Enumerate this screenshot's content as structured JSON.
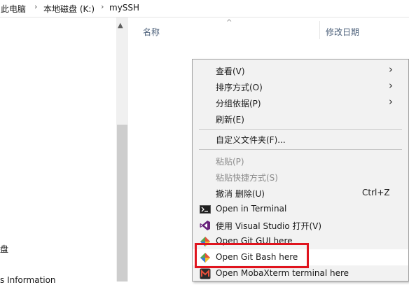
{
  "breadcrumb": {
    "items": [
      "此电脑",
      "本地磁盘 (K:)",
      "mySSH"
    ]
  },
  "nav": {
    "fragments": [
      "盘",
      "s Information"
    ]
  },
  "file_list": {
    "columns": [
      "名称",
      "修改日期"
    ]
  },
  "context_menu": {
    "items": [
      {
        "label": "查看(V)",
        "submenu": true
      },
      {
        "label": "排序方式(O)",
        "submenu": true
      },
      {
        "label": "分组依据(P)",
        "submenu": true
      },
      {
        "label": "刷新(E)"
      },
      {
        "label": "自定义文件夹(F)..."
      },
      {
        "label": "粘贴(P)",
        "disabled": true
      },
      {
        "label": "粘贴快捷方式(S)",
        "disabled": true
      },
      {
        "label": "撤消 删除(U)",
        "shortcut": "Ctrl+Z"
      },
      {
        "label": "Open in Terminal",
        "icon": "terminal-icon"
      },
      {
        "label": "使用 Visual Studio 打开(V)",
        "icon": "visual-studio-icon"
      },
      {
        "label": "Open Git GUI here",
        "icon": "git-icon"
      },
      {
        "label": "Open Git Bash here",
        "icon": "git-icon",
        "highlighted": true
      },
      {
        "label": "Open MobaXterm terminal here",
        "icon": "mobaxterm-icon"
      }
    ]
  },
  "colors": {
    "highlight_border": "#e0141e",
    "menu_bg": "#f2f2f2"
  }
}
